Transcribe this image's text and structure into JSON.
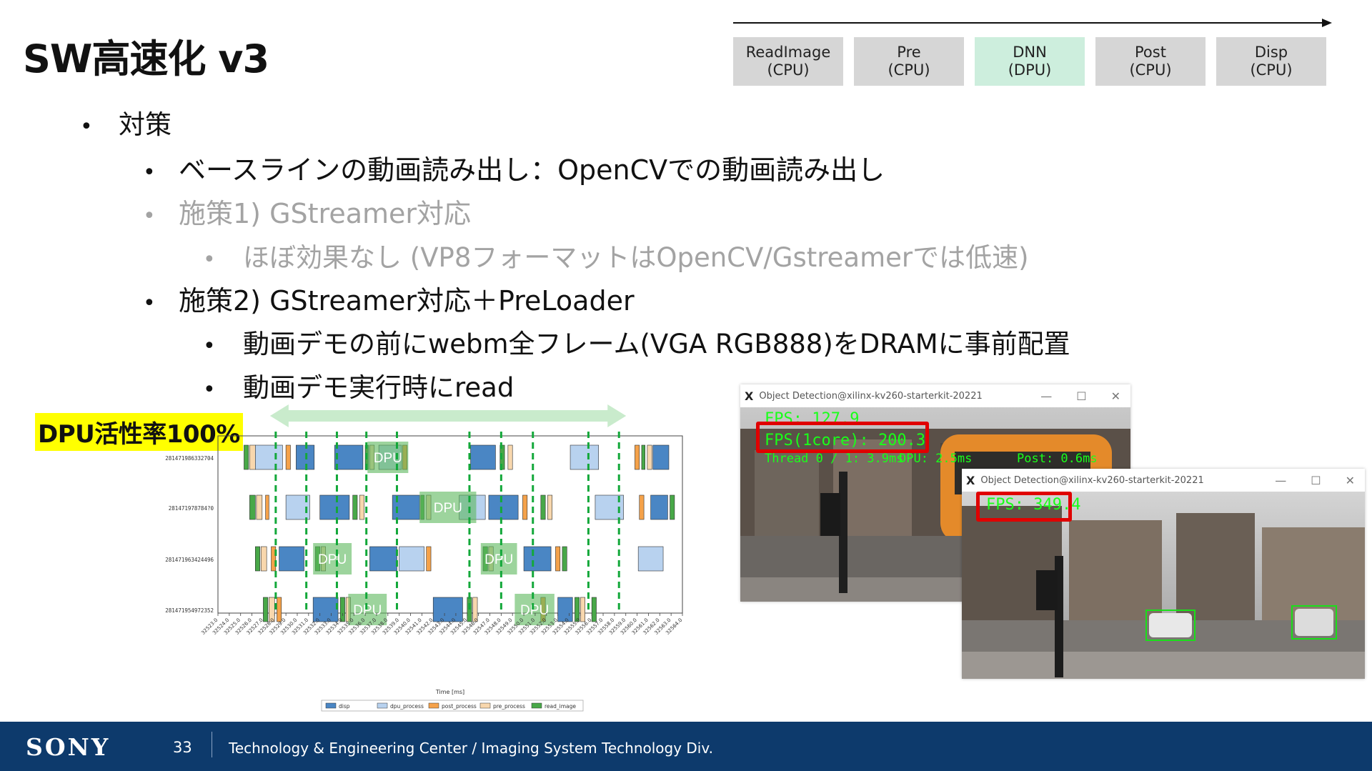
{
  "slide": {
    "title": "SW高速化 v3",
    "page_number": "33",
    "footer_org": "Technology & Engineering Center / Imaging System Technology Div.",
    "brand": "SONY"
  },
  "pipeline": {
    "stages": [
      {
        "name": "ReadImage",
        "unit": "(CPU)",
        "highlight": false
      },
      {
        "name": "Pre",
        "unit": "(CPU)",
        "highlight": false
      },
      {
        "name": "DNN",
        "unit": "(DPU)",
        "highlight": true
      },
      {
        "name": "Post",
        "unit": "(CPU)",
        "highlight": false
      },
      {
        "name": "Disp",
        "unit": "(CPU)",
        "highlight": false
      }
    ]
  },
  "bullets": {
    "b1": "対策",
    "b2": "ベースラインの動画読み出し：OpenCVでの動画読み出し",
    "b3": "施策1) GStreamer対応",
    "b4": "ほぼ効果なし (VP8フォーマットはOpenCV/Gstreamerでは低速)",
    "b5": "施策2) GStreamer対応＋PreLoader",
    "b6": "動画デモの前にwebm全フレーム(VGA RGB888)をDRAMに事前配置",
    "b7": "動画デモ実行時にread"
  },
  "dpu_badge": "DPU活性率100%",
  "screens": {
    "window_title": "Object Detection@xilinx-kv260-starterkit-20221",
    "back": {
      "fps": "FPS: 127.9",
      "fps_core": "FPS(1core): 200.3",
      "thread_info": "Thread 0 / 1: 3.9ms",
      "dpu_time": "DPU: 2.5ms",
      "post_time": "Post: 0.6ms"
    },
    "front": {
      "fps": "FPS: 349.4"
    }
  },
  "chart_data": {
    "type": "gantt",
    "xlabel": "Time [ms]",
    "threads": [
      "281471986332704",
      "281471978784?0",
      "281471963424496",
      "281471954972352"
    ],
    "annotation_label": "DPU",
    "legend": [
      "disp",
      "dpu_process",
      "post_process",
      "pre_process",
      "read_image"
    ],
    "legend_colors": [
      "#4a86c4",
      "#b8d2ef",
      "#f5a24a",
      "#f8d7ad",
      "#48a848"
    ],
    "x_ticks": [
      "32523.0",
      "32524.0",
      "32525.0",
      "32526.0",
      "32527.0",
      "32528.0",
      "32529.0",
      "32530.0",
      "32531.0",
      "32532.0",
      "32533.0",
      "32534.0",
      "32535.0",
      "32536.0",
      "32537.0",
      "32538.0",
      "32539.0",
      "32540.0",
      "32541.0",
      "32542.0",
      "32543.0",
      "32544.0",
      "32545.0",
      "32546.0",
      "32547.0",
      "32548.0",
      "32549.0",
      "32550.0",
      "32551.0",
      "32552.0",
      "32553.0",
      "32554.0",
      "32555.0",
      "32556.0",
      "32557.0",
      "32558.0",
      "32559.0",
      "32560.0",
      "32561.0",
      "32562.0",
      "32563.0",
      "32564.0"
    ],
    "xlim": [
      32523.0,
      32564.0
    ],
    "tasks": [
      {
        "thread": 0,
        "type": "read_image",
        "start": 32525.3,
        "end": 32525.7
      },
      {
        "thread": 0,
        "type": "pre_process",
        "start": 32525.8,
        "end": 32526.3
      },
      {
        "thread": 0,
        "type": "dpu_process",
        "start": 32526.3,
        "end": 32528.7
      },
      {
        "thread": 0,
        "type": "post_process",
        "start": 32529.0,
        "end": 32529.4
      },
      {
        "thread": 0,
        "type": "disp",
        "start": 32529.9,
        "end": 32531.5
      },
      {
        "thread": 0,
        "type": "disp",
        "start": 32533.3,
        "end": 32535.8
      },
      {
        "thread": 0,
        "type": "read_image",
        "start": 32536.0,
        "end": 32536.3
      },
      {
        "thread": 0,
        "type": "pre_process",
        "start": 32536.4,
        "end": 32536.8
      },
      {
        "thread": 0,
        "type": "dpu_process",
        "start": 32537.2,
        "end": 32539.2
      },
      {
        "thread": 0,
        "type": "post_process",
        "start": 32539.3,
        "end": 32539.7
      },
      {
        "thread": 0,
        "type": "disp",
        "start": 32545.3,
        "end": 32547.5
      },
      {
        "thread": 0,
        "type": "read_image",
        "start": 32547.9,
        "end": 32548.3
      },
      {
        "thread": 0,
        "type": "pre_process",
        "start": 32548.6,
        "end": 32549.0
      },
      {
        "thread": 0,
        "type": "dpu_process",
        "start": 32554.1,
        "end": 32556.6
      },
      {
        "thread": 0,
        "type": "post_process",
        "start": 32559.8,
        "end": 32560.2
      },
      {
        "thread": 0,
        "type": "read_image",
        "start": 32560.4,
        "end": 32560.7
      },
      {
        "thread": 0,
        "type": "pre_process",
        "start": 32560.9,
        "end": 32561.3
      },
      {
        "thread": 0,
        "type": "disp",
        "start": 32561.4,
        "end": 32562.8
      },
      {
        "thread": 1,
        "type": "read_image",
        "start": 32525.8,
        "end": 32526.3
      },
      {
        "thread": 1,
        "type": "pre_process",
        "start": 32526.4,
        "end": 32526.9
      },
      {
        "thread": 1,
        "type": "post_process",
        "start": 32527.2,
        "end": 32527.5
      },
      {
        "thread": 1,
        "type": "dpu_process",
        "start": 32529.0,
        "end": 32531.1
      },
      {
        "thread": 1,
        "type": "disp",
        "start": 32532.0,
        "end": 32534.6
      },
      {
        "thread": 1,
        "type": "read_image",
        "start": 32534.9,
        "end": 32535.3
      },
      {
        "thread": 1,
        "type": "pre_process",
        "start": 32535.5,
        "end": 32535.9
      },
      {
        "thread": 1,
        "type": "disp",
        "start": 32538.4,
        "end": 32540.8
      },
      {
        "thread": 1,
        "type": "read_image",
        "start": 32540.9,
        "end": 32541.2
      },
      {
        "thread": 1,
        "type": "pre_process",
        "start": 32541.4,
        "end": 32541.8
      },
      {
        "thread": 1,
        "type": "dpu_process",
        "start": 32544.3,
        "end": 32546.6
      },
      {
        "thread": 1,
        "type": "disp",
        "start": 32546.9,
        "end": 32549.5
      },
      {
        "thread": 1,
        "type": "post_process",
        "start": 32549.9,
        "end": 32550.3
      },
      {
        "thread": 1,
        "type": "read_image",
        "start": 32551.5,
        "end": 32551.9
      },
      {
        "thread": 1,
        "type": "pre_process",
        "start": 32552.1,
        "end": 32552.5
      },
      {
        "thread": 1,
        "type": "dpu_process",
        "start": 32556.3,
        "end": 32558.8
      },
      {
        "thread": 1,
        "type": "post_process",
        "start": 32560.2,
        "end": 32560.6
      },
      {
        "thread": 1,
        "type": "disp",
        "start": 32561.2,
        "end": 32562.7
      },
      {
        "thread": 1,
        "type": "read_image",
        "start": 32562.9,
        "end": 32563.3
      },
      {
        "thread": 2,
        "type": "read_image",
        "start": 32526.3,
        "end": 32526.7
      },
      {
        "thread": 2,
        "type": "pre_process",
        "start": 32526.8,
        "end": 32527.3
      },
      {
        "thread": 2,
        "type": "post_process",
        "start": 32527.7,
        "end": 32528.1
      },
      {
        "thread": 2,
        "type": "disp",
        "start": 32528.4,
        "end": 32530.6
      },
      {
        "thread": 2,
        "type": "read_image",
        "start": 32531.6,
        "end": 32532.0
      },
      {
        "thread": 2,
        "type": "pre_process",
        "start": 32532.1,
        "end": 32532.5
      },
      {
        "thread": 2,
        "type": "disp",
        "start": 32536.4,
        "end": 32538.8
      },
      {
        "thread": 2,
        "type": "dpu_process",
        "start": 32539.0,
        "end": 32541.2
      },
      {
        "thread": 2,
        "type": "post_process",
        "start": 32541.4,
        "end": 32541.8
      },
      {
        "thread": 2,
        "type": "read_image",
        "start": 32546.4,
        "end": 32546.8
      },
      {
        "thread": 2,
        "type": "pre_process",
        "start": 32546.9,
        "end": 32547.3
      },
      {
        "thread": 2,
        "type": "disp",
        "start": 32550.0,
        "end": 32552.4
      },
      {
        "thread": 2,
        "type": "post_process",
        "start": 32552.8,
        "end": 32553.2
      },
      {
        "thread": 2,
        "type": "read_image",
        "start": 32553.4,
        "end": 32553.8
      },
      {
        "thread": 2,
        "type": "dpu_process",
        "start": 32560.1,
        "end": 32562.3
      },
      {
        "thread": 3,
        "type": "read_image",
        "start": 32527.0,
        "end": 32527.4
      },
      {
        "thread": 3,
        "type": "pre_process",
        "start": 32527.5,
        "end": 32528.0
      },
      {
        "thread": 3,
        "type": "post_process",
        "start": 32528.2,
        "end": 32528.6
      },
      {
        "thread": 3,
        "type": "disp",
        "start": 32531.4,
        "end": 32533.6
      },
      {
        "thread": 3,
        "type": "read_image",
        "start": 32533.8,
        "end": 32534.2
      },
      {
        "thread": 3,
        "type": "pre_process",
        "start": 32534.3,
        "end": 32534.7
      },
      {
        "thread": 3,
        "type": "disp",
        "start": 32542.0,
        "end": 32544.6
      },
      {
        "thread": 3,
        "type": "read_image",
        "start": 32545.0,
        "end": 32545.4
      },
      {
        "thread": 3,
        "type": "pre_process",
        "start": 32545.5,
        "end": 32545.9
      },
      {
        "thread": 3,
        "type": "post_process",
        "start": 32551.5,
        "end": 32551.9
      },
      {
        "thread": 3,
        "type": "disp",
        "start": 32553.0,
        "end": 32554.3
      },
      {
        "thread": 3,
        "type": "read_image",
        "start": 32554.5,
        "end": 32554.9
      },
      {
        "thread": 3,
        "type": "pre_process",
        "start": 32555.0,
        "end": 32555.4
      },
      {
        "thread": 3,
        "type": "read_image",
        "start": 32556.0,
        "end": 32556.4
      }
    ],
    "dpu_annotations": [
      {
        "thread": 0,
        "start": 32536.2,
        "end": 32539.8
      },
      {
        "thread": 1,
        "start": 32540.8,
        "end": 32545.8
      },
      {
        "thread": 2,
        "start": 32531.4,
        "end": 32534.8
      },
      {
        "thread": 2,
        "start": 32546.2,
        "end": 32549.4
      },
      {
        "thread": 3,
        "start": 32534.5,
        "end": 32537.9
      },
      {
        "thread": 3,
        "start": 32549.2,
        "end": 32552.7
      }
    ],
    "dashed_markers": [
      32528.1,
      32530.8,
      32533.5,
      32536.1,
      32538.8,
      32545.2,
      32548.0,
      32550.8,
      32555.7,
      32558.4
    ],
    "active_span": [
      32528.1,
      32558.4
    ]
  }
}
